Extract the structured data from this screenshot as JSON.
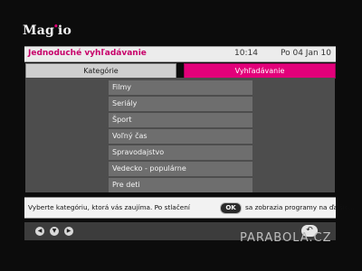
{
  "brand": {
    "logo_main": "Ma",
    "logo_mid": "g",
    "logo_end": "io"
  },
  "header": {
    "title": "Jednoduché vyhľadávanie",
    "time": "10:14",
    "date": "Po 04 Jan 10"
  },
  "tabs": {
    "categories": "Kategórie",
    "search": "Vyhľadávanie"
  },
  "categories": [
    "Filmy",
    "Seriály",
    "Šport",
    "Voľný čas",
    "Spravodajstvo",
    "Vedecko - populárne",
    "Pre deti"
  ],
  "message": {
    "part1": "Vyberte kategóriu, ktorá vás zaujíma. Po stlačení",
    "ok_label": "OK",
    "part2": "sa zobrazia programy na ďalšíc..."
  },
  "nav_icons": [
    "left-arrow-icon",
    "down-arrow-icon",
    "right-arrow-icon",
    "back-icon"
  ],
  "watermark": "PARABOLA.CZ",
  "colors": {
    "accent": "#e3007a",
    "panel": "#4d4d4d",
    "item": "#6e6e6e"
  }
}
